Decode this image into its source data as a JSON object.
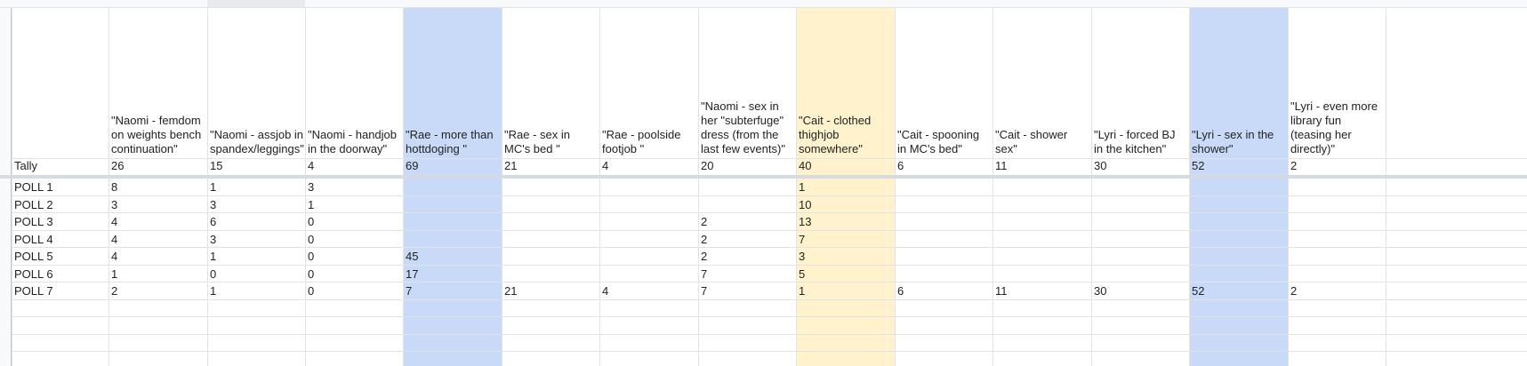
{
  "colors": {
    "blue_highlight": "#c9daf8",
    "yellow_highlight": "#fff2cc",
    "gridline": "#e2e3e3",
    "frozen_divider": "#d6dbe3"
  },
  "sheet": {
    "headers": [
      "",
      "\"Naomi - femdom on weights bench continuation\"",
      "\"Naomi - assjob in spandex/leggings\"",
      "\"Naomi - handjob in the doorway\"",
      "\"Rae - more than hottdoging \"",
      "\"Rae - sex in MC's bed \"",
      "\"Rae - poolside footjob \"",
      "\"Naomi - sex in her \"subterfuge\" dress (from the last few events)\"",
      "\"Cait - clothed thighjob somewhere\"",
      "\"Cait - spooning in MC's bed\"",
      "\"Cait - shower sex\"",
      "\"Lyri - forced BJ in the kitchen\"",
      "\"Lyri - sex in the shower\"",
      "\"Lyri - even more library fun (teasing her directly)\""
    ],
    "rows": [
      [
        "Tally",
        "26",
        "15",
        "4",
        "69",
        "21",
        "4",
        "20",
        "40",
        "6",
        "11",
        "30",
        "52",
        "2"
      ],
      [
        "POLL 1",
        "8",
        "1",
        "3",
        "",
        "",
        "",
        "",
        "1",
        "",
        "",
        "",
        "",
        ""
      ],
      [
        "POLL 2",
        "3",
        "3",
        "1",
        "",
        "",
        "",
        "",
        "10",
        "",
        "",
        "",
        "",
        ""
      ],
      [
        "POLL 3",
        "4",
        "6",
        "0",
        "",
        "",
        "",
        "2",
        "13",
        "",
        "",
        "",
        "",
        ""
      ],
      [
        "POLL 4",
        "4",
        "3",
        "0",
        "",
        "",
        "",
        "2",
        "7",
        "",
        "",
        "",
        "",
        ""
      ],
      [
        "POLL 5",
        "4",
        "1",
        "0",
        "45",
        "",
        "",
        "2",
        "3",
        "",
        "",
        "",
        "",
        ""
      ],
      [
        "POLL 6",
        "1",
        "0",
        "0",
        "17",
        "",
        "",
        "7",
        "5",
        "",
        "",
        "",
        "",
        ""
      ],
      [
        "POLL 7",
        "2",
        "1",
        "0",
        "7",
        "21",
        "4",
        "7",
        "1",
        "6",
        "11",
        "30",
        "52",
        "2"
      ]
    ]
  }
}
